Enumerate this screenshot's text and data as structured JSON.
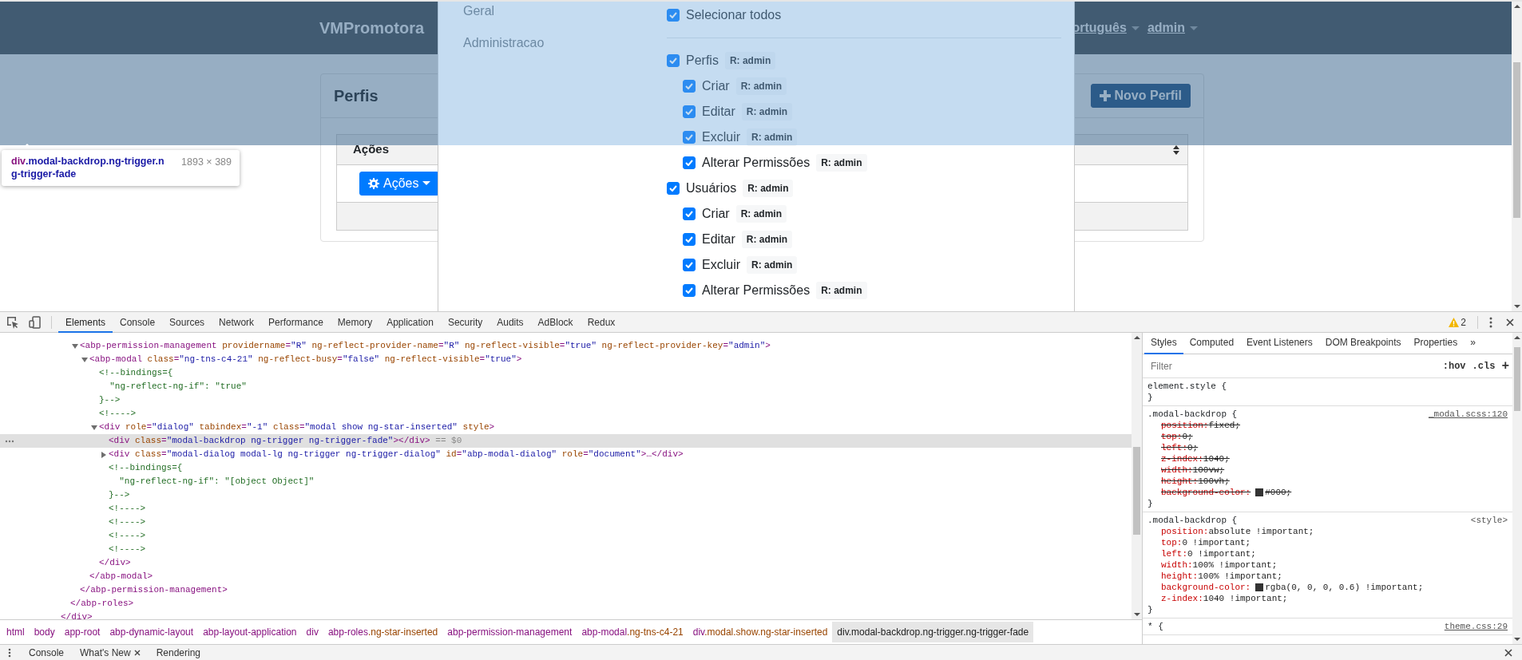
{
  "page": {
    "brand": "VMPromotora",
    "nav_items": [
      {
        "label": "ortuguês"
      },
      {
        "label": "admin"
      }
    ],
    "card": {
      "title": "Perfis",
      "new_button": "Novo Perfil",
      "column": "Ações",
      "actions_button": "Ações"
    }
  },
  "modal": {
    "nav": [
      {
        "label": "Geral"
      },
      {
        "label": "Administracao"
      }
    ],
    "select_all": {
      "label": "Selecionar todos",
      "checked": true
    },
    "permissions": [
      {
        "label": "Perfis",
        "badge": "R: admin",
        "checked": true,
        "children": [
          {
            "label": "Criar",
            "badge": "R: admin",
            "checked": true
          },
          {
            "label": "Editar",
            "badge": "R: admin",
            "checked": true
          },
          {
            "label": "Excluir",
            "badge": "R: admin",
            "checked": true
          },
          {
            "label": "Alterar Permissões",
            "badge": "R: admin",
            "checked": true
          }
        ]
      },
      {
        "label": "Usuários",
        "badge": "R: admin",
        "checked": true,
        "children": [
          {
            "label": "Criar",
            "badge": "R: admin",
            "checked": true
          },
          {
            "label": "Editar",
            "badge": "R: admin",
            "checked": true
          },
          {
            "label": "Excluir",
            "badge": "R: admin",
            "checked": true
          },
          {
            "label": "Alterar Permissões",
            "badge": "R: admin",
            "checked": true
          }
        ]
      }
    ]
  },
  "inspect_tooltip": {
    "tag": "div",
    "classes": ".modal-backdrop.ng-trigger.ng-trigger-fade",
    "size": "1893 × 389"
  },
  "devtools": {
    "tabs": [
      {
        "label": "Elements",
        "selected": true
      },
      {
        "label": "Console",
        "selected": false
      },
      {
        "label": "Sources",
        "selected": false
      },
      {
        "label": "Network",
        "selected": false
      },
      {
        "label": "Performance",
        "selected": false
      },
      {
        "label": "Memory",
        "selected": false
      },
      {
        "label": "Application",
        "selected": false
      },
      {
        "label": "Security",
        "selected": false
      },
      {
        "label": "Audits",
        "selected": false
      },
      {
        "label": "AdBlock",
        "selected": false
      },
      {
        "label": "Redux",
        "selected": false
      }
    ],
    "warnings": "2",
    "dom_tree": [
      {
        "selected": false,
        "close": [
          {
            "kind": "tag",
            "text": "</div>"
          }
        ],
        "children": [
          {
            "selected": false,
            "close": [
              {
                "kind": "tag",
                "text": "</abp-roles>"
              }
            ],
            "children": [
              {
                "selected": false,
                "expanded": true,
                "lines": [
                  [
                    {
                      "kind": "tag",
                      "text": "<abp-permission-management"
                    },
                    {
                      "kind": "attr",
                      "text": " providername"
                    },
                    {
                      "kind": "tag",
                      "text": "="
                    },
                    {
                      "kind": "value",
                      "text": "\"R\""
                    },
                    {
                      "kind": "attr",
                      "text": " ng-reflect-provider-name"
                    },
                    {
                      "kind": "tag",
                      "text": "="
                    },
                    {
                      "kind": "value",
                      "text": "\"R\""
                    },
                    {
                      "kind": "attr",
                      "text": " ng-reflect-visible"
                    },
                    {
                      "kind": "tag",
                      "text": "="
                    },
                    {
                      "kind": "value",
                      "text": "\"true\""
                    },
                    {
                      "kind": "attr",
                      "text": " ng-reflect-provider-key"
                    },
                    {
                      "kind": "tag",
                      "text": "="
                    },
                    {
                      "kind": "value",
                      "text": "\"admin\""
                    },
                    {
                      "kind": "tag",
                      "text": ">"
                    }
                  ]
                ],
                "close": [
                  {
                    "kind": "tag",
                    "text": "</abp-permission-management>"
                  }
                ],
                "children": [
                  {
                    "selected": false,
                    "expanded": true,
                    "lines": [
                      [
                        {
                          "kind": "tag",
                          "text": "<abp-modal"
                        },
                        {
                          "kind": "attr",
                          "text": " class"
                        },
                        {
                          "kind": "tag",
                          "text": "="
                        },
                        {
                          "kind": "value",
                          "text": "\"ng-tns-c4-21\""
                        },
                        {
                          "kind": "attr",
                          "text": " ng-reflect-busy"
                        },
                        {
                          "kind": "tag",
                          "text": "="
                        },
                        {
                          "kind": "value",
                          "text": "\"false\""
                        },
                        {
                          "kind": "attr",
                          "text": " ng-reflect-visible"
                        },
                        {
                          "kind": "tag",
                          "text": "="
                        },
                        {
                          "kind": "value",
                          "text": "\"true\""
                        },
                        {
                          "kind": "tag",
                          "text": ">"
                        }
                      ]
                    ],
                    "close": [
                      {
                        "kind": "tag",
                        "text": "</abp-modal>"
                      }
                    ],
                    "children": [
                      {
                        "selected": false,
                        "lines": [
                          [
                            {
                              "kind": "comment",
                              "text": "<!--bindings={"
                            }
                          ],
                          [
                            {
                              "kind": "comment",
                              "text": "  \"ng-reflect-ng-if\": \"true\""
                            }
                          ],
                          [
                            {
                              "kind": "comment",
                              "text": "}-->"
                            }
                          ]
                        ]
                      },
                      {
                        "selected": false,
                        "lines": [
                          [
                            {
                              "kind": "comment",
                              "text": "<!---->"
                            }
                          ]
                        ]
                      },
                      {
                        "selected": false,
                        "expanded": true,
                        "lines": [
                          [
                            {
                              "kind": "tag",
                              "text": "<div"
                            },
                            {
                              "kind": "attr",
                              "text": " role"
                            },
                            {
                              "kind": "tag",
                              "text": "="
                            },
                            {
                              "kind": "value",
                              "text": "\"dialog\""
                            },
                            {
                              "kind": "attr",
                              "text": " tabindex"
                            },
                            {
                              "kind": "tag",
                              "text": "="
                            },
                            {
                              "kind": "value",
                              "text": "\"-1\""
                            },
                            {
                              "kind": "attr",
                              "text": " class"
                            },
                            {
                              "kind": "tag",
                              "text": "="
                            },
                            {
                              "kind": "value",
                              "text": "\"modal show ng-star-inserted\""
                            },
                            {
                              "kind": "attr",
                              "text": " style"
                            },
                            {
                              "kind": "tag",
                              "text": ">"
                            }
                          ]
                        ],
                        "close": [
                          {
                            "kind": "tag",
                            "text": "</div>"
                          }
                        ],
                        "children": [
                          {
                            "selected": true,
                            "lines": [
                              [
                                {
                                  "kind": "tag",
                                  "text": "<div"
                                },
                                {
                                  "kind": "attr",
                                  "text": " class"
                                },
                                {
                                  "kind": "tag",
                                  "text": "="
                                },
                                {
                                  "kind": "value",
                                  "text": "\"modal-backdrop ng-trigger ng-trigger-fade\""
                                },
                                {
                                  "kind": "tag",
                                  "text": "></div>"
                                },
                                {
                                  "kind": "note",
                                  "text": " == $0"
                                }
                              ]
                            ]
                          },
                          {
                            "selected": false,
                            "expanded": false,
                            "lines": [
                              [
                                {
                                  "kind": "tag",
                                  "text": "<div"
                                },
                                {
                                  "kind": "attr",
                                  "text": " class"
                                },
                                {
                                  "kind": "tag",
                                  "text": "="
                                },
                                {
                                  "kind": "value",
                                  "text": "\"modal-dialog modal-lg ng-trigger ng-trigger-dialog\""
                                },
                                {
                                  "kind": "attr",
                                  "text": " id"
                                },
                                {
                                  "kind": "tag",
                                  "text": "="
                                },
                                {
                                  "kind": "value",
                                  "text": "\"abp-modal-dialog\""
                                },
                                {
                                  "kind": "attr",
                                  "text": " role"
                                },
                                {
                                  "kind": "tag",
                                  "text": "="
                                },
                                {
                                  "kind": "value",
                                  "text": "\"document\""
                                },
                                {
                                  "kind": "tag",
                                  "text": ">…</div>"
                                }
                              ]
                            ]
                          },
                          {
                            "selected": false,
                            "lines": [
                              [
                                {
                                  "kind": "comment",
                                  "text": "<!--bindings={"
                                }
                              ],
                              [
                                {
                                  "kind": "comment",
                                  "text": "  \"ng-reflect-ng-if\": \"[object Object]\""
                                }
                              ],
                              [
                                {
                                  "kind": "comment",
                                  "text": "}-->"
                                }
                              ]
                            ]
                          },
                          {
                            "selected": false,
                            "lines": [
                              [
                                {
                                  "kind": "comment",
                                  "text": "<!---->"
                                }
                              ]
                            ]
                          },
                          {
                            "selected": false,
                            "lines": [
                              [
                                {
                                  "kind": "comment",
                                  "text": "<!---->"
                                }
                              ]
                            ]
                          },
                          {
                            "selected": false,
                            "lines": [
                              [
                                {
                                  "kind": "comment",
                                  "text": "<!---->"
                                }
                              ]
                            ]
                          },
                          {
                            "selected": false,
                            "lines": [
                              [
                                {
                                  "kind": "comment",
                                  "text": "<!---->"
                                }
                              ]
                            ]
                          }
                        ]
                      }
                    ]
                  }
                ]
              }
            ]
          }
        ]
      }
    ],
    "breadcrumbs": [
      {
        "tag": "html",
        "selected": false
      },
      {
        "tag": "body",
        "selected": false
      },
      {
        "tag": "app-root",
        "selected": false
      },
      {
        "tag": "abp-dynamic-layout",
        "selected": false
      },
      {
        "tag": "abp-layout-application",
        "selected": false
      },
      {
        "tag": "div",
        "selected": false
      },
      {
        "tag": "abp-roles",
        "classes": ".ng-star-inserted",
        "selected": false
      },
      {
        "tag": "abp-permission-management",
        "selected": false
      },
      {
        "tag": "abp-modal",
        "classes": ".ng-tns-c4-21",
        "selected": false
      },
      {
        "tag": "div",
        "classes": ".modal.show.ng-star-inserted",
        "selected": false
      },
      {
        "tag": "div",
        "classes": ".modal-backdrop.ng-trigger.ng-trigger-fade",
        "selected": true
      }
    ],
    "styles": {
      "tabs": [
        {
          "label": "Styles",
          "selected": true
        },
        {
          "label": "Computed",
          "selected": false
        },
        {
          "label": "Event Listeners",
          "selected": false
        },
        {
          "label": "DOM Breakpoints",
          "selected": false
        },
        {
          "label": "Properties",
          "selected": false
        }
      ],
      "more": "»",
      "filter_placeholder": "Filter",
      "hov": ":hov",
      "cls": ".cls",
      "add": "+",
      "rules": [
        {
          "selector": "element.style {",
          "close": "}"
        },
        {
          "selector": ".modal-backdrop {",
          "source": "_modal.scss:120",
          "linked": true,
          "close": "}",
          "declarations": [
            {
              "name": "position:",
              "value": "fixed;",
              "overridden": true
            },
            {
              "name": "top:",
              "value": "0;",
              "overridden": true
            },
            {
              "name": "left:",
              "value": "0;",
              "overridden": true
            },
            {
              "name": "z-index:",
              "value": "1040;",
              "overridden": true
            },
            {
              "name": "width:",
              "value": "100vw;",
              "overridden": true
            },
            {
              "name": "height:",
              "value": "100vh;",
              "overridden": true
            },
            {
              "name": "background-color:",
              "value": "#000;",
              "overridden": true,
              "kind": "color"
            }
          ]
        },
        {
          "selector": ".modal-backdrop {",
          "source": "<style>",
          "linked": false,
          "close": "}",
          "declarations": [
            {
              "name": "position:",
              "value": "absolute !important;",
              "overridden": false
            },
            {
              "name": "top:",
              "value": "0 !important;",
              "overridden": false
            },
            {
              "name": "left:",
              "value": "0 !important;",
              "overridden": false
            },
            {
              "name": "width:",
              "value": "100% !important;",
              "overridden": false
            },
            {
              "name": "height:",
              "value": "100% !important;",
              "overridden": false
            },
            {
              "name": "background-color:",
              "value": "rgba(0, 0, 0, 0.6) !important;",
              "overridden": false,
              "kind": "color"
            },
            {
              "name": "z-index:",
              "value": "1040 !important;",
              "overridden": false
            }
          ]
        },
        {
          "selector": "* {",
          "source": "theme.css:29",
          "linked": true
        }
      ]
    },
    "drawer": {
      "tabs": [
        {
          "label": "Console",
          "closable": false
        },
        {
          "label": "What's New",
          "closable": true
        },
        {
          "label": "Rendering",
          "closable": false
        }
      ]
    }
  }
}
